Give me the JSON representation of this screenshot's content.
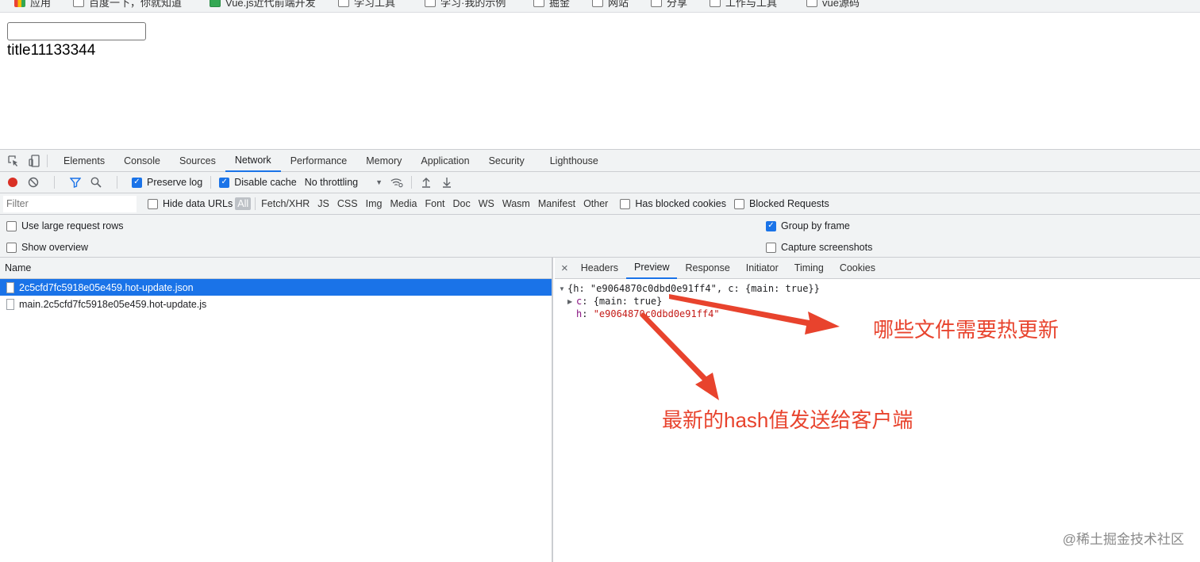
{
  "browser": {
    "bookmarks": [
      "应用",
      "百度一下，你就知道",
      "Vue.js近代前端开发",
      "学习工具",
      "学习·我的示例",
      "掘金",
      "网站",
      "分享",
      "工作与工具",
      "vue源码"
    ]
  },
  "page": {
    "input_value": "",
    "title_text": "title11133344"
  },
  "devtools": {
    "panel_tabs": [
      "Elements",
      "Console",
      "Sources",
      "Network",
      "Performance",
      "Memory",
      "Application",
      "Security",
      "Lighthouse"
    ],
    "active_panel": "Network",
    "toolbar": {
      "preserve_log": "Preserve log",
      "preserve_log_checked": true,
      "disable_cache": "Disable cache",
      "disable_cache_checked": true,
      "throttling": "No throttling"
    },
    "filter": {
      "placeholder": "Filter",
      "hide_data_urls": "Hide data URLs",
      "types": [
        "All",
        "Fetch/XHR",
        "JS",
        "CSS",
        "Img",
        "Media",
        "Font",
        "Doc",
        "WS",
        "Wasm",
        "Manifest",
        "Other"
      ],
      "active_type": "All",
      "has_blocked_cookies": "Has blocked cookies",
      "blocked_requests": "Blocked Requests"
    },
    "settings": {
      "use_large_rows": "Use large request rows",
      "show_overview": "Show overview",
      "group_by_frame": "Group by frame",
      "group_by_frame_checked": true,
      "capture_screenshots": "Capture screenshots"
    },
    "list": {
      "header_name": "Name",
      "requests": [
        {
          "name": "2c5cfd7fc5918e05e459.hot-update.json",
          "selected": true
        },
        {
          "name": "main.2c5cfd7fc5918e05e459.hot-update.js",
          "selected": false
        }
      ]
    },
    "details": {
      "close": "×",
      "tabs": [
        "Headers",
        "Preview",
        "Response",
        "Initiator",
        "Timing",
        "Cookies"
      ],
      "active_tab": "Preview",
      "preview_root": "{h: \"e9064870c0dbd0e91ff4\", c: {main: true}}",
      "preview_c_key": "c",
      "preview_c_val": "{main: true}",
      "preview_h_key": "h",
      "preview_h_val": "\"e9064870c0dbd0e91ff4\""
    }
  },
  "annotations": {
    "files_to_update": "哪些文件需要热更新",
    "latest_hash": "最新的hash值发送给客户端",
    "color": "#e8432d"
  },
  "watermark": "@稀土掘金技术社区"
}
